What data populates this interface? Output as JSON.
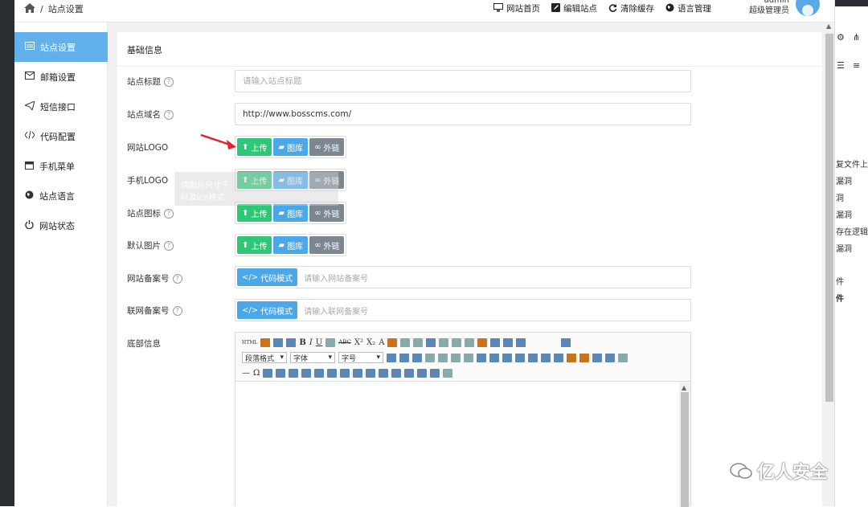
{
  "breadcrumb": {
    "separator": "/",
    "current": "站点设置"
  },
  "topnav": [
    {
      "label": "网站首页",
      "icon": "monitor-icon"
    },
    {
      "label": "编辑站点",
      "icon": "edit-icon"
    },
    {
      "label": "清除缓存",
      "icon": "refresh-icon"
    },
    {
      "label": "语言管理",
      "icon": "globe-icon"
    }
  ],
  "user": {
    "name": "admin",
    "role": "超级管理员"
  },
  "sidebar": {
    "items": [
      {
        "label": "站点设置",
        "icon": "settings-icon",
        "active": true
      },
      {
        "label": "邮箱设置",
        "icon": "mail-icon"
      },
      {
        "label": "短信接口",
        "icon": "send-icon"
      },
      {
        "label": "代码配置",
        "icon": "code-icon"
      },
      {
        "label": "手机菜单",
        "icon": "calendar-icon"
      },
      {
        "label": "站点语言",
        "icon": "globe-icon"
      },
      {
        "label": "网站状态",
        "icon": "power-icon"
      }
    ]
  },
  "panel": {
    "title": "基础信息",
    "fields": {
      "site_title": {
        "label": "站点标题",
        "placeholder": "请输入站点标题",
        "value": ""
      },
      "site_domain": {
        "label": "站点域名",
        "value": "http://www.bosscms.com/"
      },
      "site_logo": {
        "label": "网站LOGO"
      },
      "mobile_logo": {
        "label": "手机LOGO"
      },
      "site_icon": {
        "label": "站点图标"
      },
      "default_image": {
        "label": "默认图片"
      },
      "icp": {
        "label": "网站备案号",
        "placeholder": "请输入网站备案号"
      },
      "police": {
        "label": "联网备案号",
        "placeholder": "请输入联网备案号"
      },
      "footer": {
        "label": "底部信息"
      }
    },
    "buttons": {
      "upload": "上传",
      "library": "图库",
      "external": "外链",
      "code_mode": "代码模式"
    }
  },
  "tooltip": {
    "line1": "请图片尺寸于",
    "line2": "以及ico格式"
  },
  "editor": {
    "selects": {
      "paragraph": "段落格式",
      "font": "字体",
      "size": "字号"
    },
    "toolbar_text": {
      "html": "HTML",
      "bold": "B",
      "italic": "I",
      "underline": "U",
      "strike": "ABC",
      "sup": "X²",
      "sub": "X₂",
      "fontcolor": "A",
      "omega": "Ω",
      "hr": "—"
    }
  },
  "right_pane": {
    "lines": [
      "复文件上传",
      "漏洞",
      "洞",
      "漏洞",
      "存在逻辑缺",
      "漏洞",
      "件",
      "件"
    ]
  },
  "watermark": {
    "text": "亿人安全"
  },
  "colors": {
    "active_blue": "#62b1ec",
    "upload_green": "#2ec776",
    "library_blue": "#4aa8e8",
    "link_gray": "#7d8791",
    "arrow_red": "#e8202a"
  }
}
